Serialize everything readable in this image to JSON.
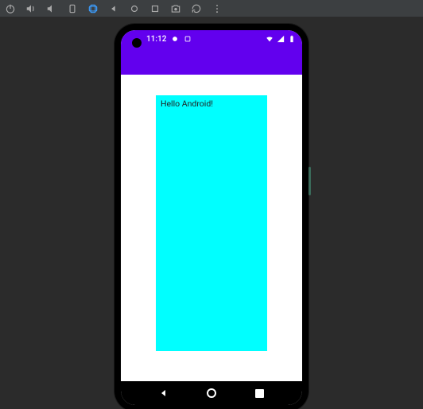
{
  "toolbar": {
    "icons": [
      "power",
      "vol-up",
      "vol-down",
      "rotate-left",
      "rotate-right",
      "back",
      "home",
      "overview",
      "screenshot",
      "reload",
      "more"
    ]
  },
  "statusbar": {
    "time": "11:12",
    "left_icons": [
      "settings-filled",
      "settings-outline"
    ],
    "right_icons": [
      "wifi",
      "signal",
      "battery"
    ]
  },
  "app": {
    "body_text": "Hello Android!",
    "box_color": "#00FFFF",
    "appbar_color": "#6200EE"
  },
  "nav": {
    "buttons": [
      "back",
      "home",
      "recent"
    ]
  }
}
